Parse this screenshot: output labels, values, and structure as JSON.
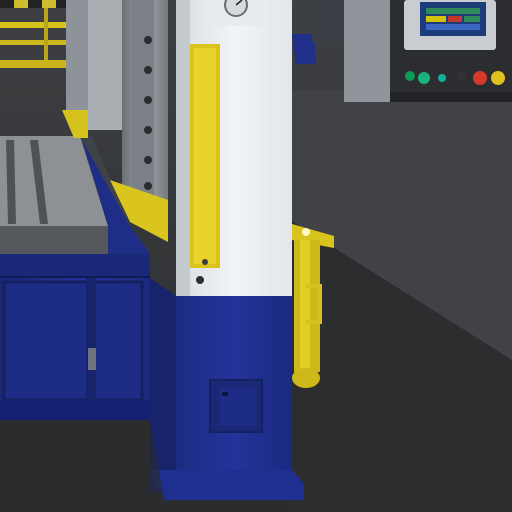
{
  "scene": {
    "subject": "industrial-press-machine-render",
    "colors": {
      "floor": "#3a3b3d",
      "floor_dark": "#2a2b2d",
      "column_white": "#e9ecef",
      "base_blue": "#1f2f8a",
      "base_blue_dark": "#17236a",
      "safety_yellow": "#e3cf1a",
      "steel": "#8c9095",
      "steel_dark": "#5d6166",
      "panel_grey": "#9aa0a6",
      "panel_dark": "#2b2d31"
    },
    "control_panel": {
      "buttons": [
        "green",
        "teal",
        "red",
        "red",
        "yellow"
      ],
      "screen_colors": [
        "#2e8b57",
        "#d4c20a",
        "#c0392b",
        "#3a66c4"
      ]
    }
  }
}
